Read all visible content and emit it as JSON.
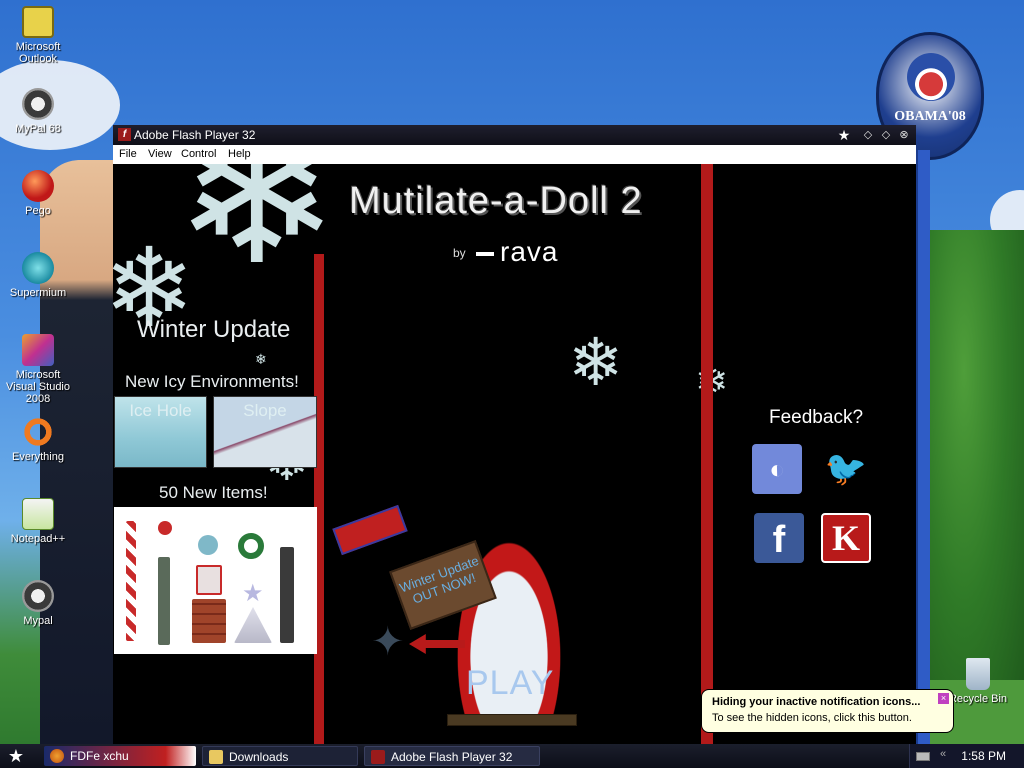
{
  "desktop": {
    "icons": [
      {
        "label": "Microsoft Outlook",
        "icon": "outlook-icon"
      },
      {
        "label": "MyPal 68",
        "icon": "mypal-icon"
      },
      {
        "label": "Pego",
        "icon": "pego-icon"
      },
      {
        "label": "Supermium",
        "icon": "supermium-icon"
      },
      {
        "label": "Microsoft Visual Studio 2008",
        "icon": "visual-studio-icon"
      },
      {
        "label": "Everything",
        "icon": "everything-icon"
      },
      {
        "label": "Notepad++",
        "icon": "notepadpp-icon"
      },
      {
        "label": "Mypal",
        "icon": "mypal-icon"
      }
    ],
    "recycle_bin_label": "Recycle Bin",
    "badge_text": "OBAMA'08"
  },
  "flash_window": {
    "title": "Adobe Flash Player 32",
    "menu": [
      "File",
      "View",
      "Control",
      "Help"
    ]
  },
  "game": {
    "title": "Mutilate-a-Doll 2",
    "by": "by",
    "author": "rava",
    "update_heading": "Winter Update",
    "environments_heading": "New Icy Environments!",
    "environments": [
      "Ice Hole",
      "Slope"
    ],
    "items_heading": "50 New Items!",
    "feedback_label": "Feedback?",
    "socials": [
      {
        "name": "discord",
        "icon": "discord-icon"
      },
      {
        "name": "twitter",
        "icon": "twitter-icon"
      },
      {
        "name": "facebook",
        "icon": "facebook-icon",
        "glyph": "f"
      },
      {
        "name": "kongregate",
        "icon": "kongregate-icon",
        "glyph": "K"
      }
    ],
    "sign_text": "Winter Update OUT NOW!",
    "play_label": "PLAY",
    "colors": {
      "accent_red": "#b21a1a",
      "snow": "#cfe3e5"
    }
  },
  "notification": {
    "title": "Hiding your inactive notification icons...",
    "body": "To see the hidden icons, click this button."
  },
  "taskbar": {
    "tasks": [
      {
        "label": "FDFe xchu",
        "icon": "firefox-icon"
      },
      {
        "label": "Downloads",
        "icon": "folder-icon"
      },
      {
        "label": "Adobe Flash Player 32",
        "icon": "flash-icon"
      }
    ],
    "clock": "1:58 PM"
  }
}
